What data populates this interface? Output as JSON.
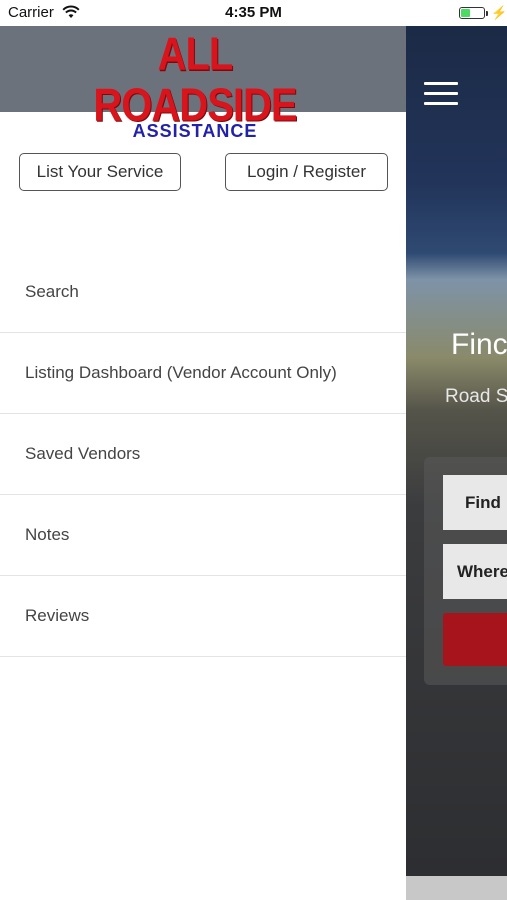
{
  "status_bar": {
    "carrier": "Carrier",
    "time": "4:35 PM",
    "battery_level_percent": 35
  },
  "drawer": {
    "logo": {
      "title": "ALL ROADSIDE",
      "subtitle": "ASSISTANCE",
      "title_color": "#d8141c",
      "subtitle_color": "#2222a8"
    },
    "buttons": {
      "list_service": "List Your Service",
      "login_register": "Login / Register"
    },
    "menu_items": [
      "Search",
      "Listing Dashboard (Vendor Account Only)",
      "Saved Vendors",
      "Notes",
      "Reviews"
    ]
  },
  "background_app": {
    "heading_partial": "Finc",
    "subheading_partial": "Road S",
    "find_field_partial": "Find",
    "where_field_partial": "Where",
    "accent_color": "#a8141c"
  }
}
